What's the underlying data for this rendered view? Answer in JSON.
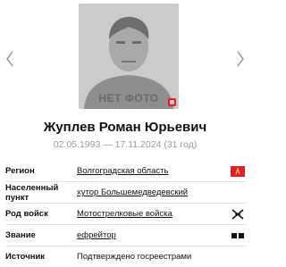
{
  "card": {
    "photo_placeholder": "НЕТ ФОТО",
    "name": "Жуплев Роман Юрьевич",
    "dates": "02.05.1993 — 17.11.2024 (31 год)"
  },
  "details": [
    {
      "label": "Регион",
      "value": "Волгоградская область",
      "link": true,
      "icon": "region-flag-icon"
    },
    {
      "label": "Населенный пункт",
      "value": "хутор Большемедведевский",
      "link": true,
      "icon": ""
    },
    {
      "label": "Род войск",
      "value": "Мотострелковые войска",
      "link": true,
      "icon": "crossed-rifles-icon"
    },
    {
      "label": "Звание",
      "value": "ефрейтор",
      "link": true,
      "icon": "rank-insignia-icon"
    },
    {
      "label": "Источник",
      "value": "Подтверждено госреестрами",
      "link": false,
      "icon": ""
    }
  ],
  "colors": {
    "accent_red": "#d8212a",
    "muted_text": "#9a9a9a"
  }
}
